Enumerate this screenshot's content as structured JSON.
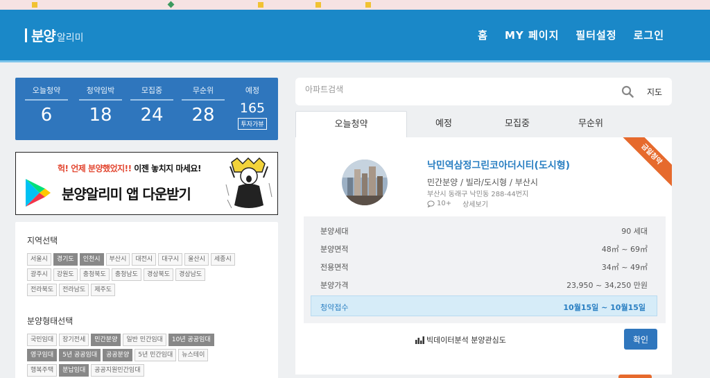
{
  "header": {
    "logo_main": "분양",
    "logo_sub": "알리미",
    "nav": [
      "홈",
      "MY 페이지",
      "필터설정",
      "로그인"
    ]
  },
  "stats": [
    {
      "label": "오늘청약",
      "value": "6"
    },
    {
      "label": "청약임박",
      "value": "18"
    },
    {
      "label": "모집중",
      "value": "24"
    },
    {
      "label": "무순위",
      "value": "28"
    },
    {
      "label": "예정",
      "value": "165",
      "button": "투자가뷰"
    }
  ],
  "banner": {
    "line1_a": "헉! 언제 분양했었지!!",
    "line1_b": " 이젠 놓치지 마세요!",
    "line2": "분양알리미 앱 다운받기"
  },
  "filters": {
    "region_title": "지역선택",
    "regions": [
      [
        {
          "t": "서울시",
          "on": false
        },
        {
          "t": "경기도",
          "on": true
        },
        {
          "t": "인천시",
          "on": true
        },
        {
          "t": "부산시",
          "on": false
        },
        {
          "t": "대전시",
          "on": false
        },
        {
          "t": "대구시",
          "on": false
        },
        {
          "t": "울산시",
          "on": false
        },
        {
          "t": "세종시",
          "on": false
        }
      ],
      [
        {
          "t": "광주시",
          "on": false
        },
        {
          "t": "강원도",
          "on": false
        },
        {
          "t": "충청북도",
          "on": false
        },
        {
          "t": "충청남도",
          "on": false
        },
        {
          "t": "경상북도",
          "on": false
        },
        {
          "t": "경상남도",
          "on": false
        }
      ],
      [
        {
          "t": "전라북도",
          "on": false
        },
        {
          "t": "전라남도",
          "on": false
        },
        {
          "t": "제주도",
          "on": false
        }
      ]
    ],
    "type_title": "분양형태선택",
    "types": [
      [
        {
          "t": "국민임대",
          "on": false
        },
        {
          "t": "장기전세",
          "on": false
        },
        {
          "t": "민간분양",
          "on": true
        },
        {
          "t": "일반 민간임대",
          "on": false
        },
        {
          "t": "10년 공공임대",
          "on": true
        }
      ],
      [
        {
          "t": "영구임대",
          "on": true
        },
        {
          "t": "5년 공공임대",
          "on": true
        },
        {
          "t": "공공분양",
          "on": true
        },
        {
          "t": "5년 민간임대",
          "on": false
        },
        {
          "t": "뉴스테이",
          "on": false
        }
      ],
      [
        {
          "t": "행복주택",
          "on": false
        },
        {
          "t": "분납임대",
          "on": true
        },
        {
          "t": "공공지원민간임대",
          "on": false
        }
      ]
    ]
  },
  "search": {
    "placeholder": "아파트검색",
    "map_label": "지도"
  },
  "tabs": [
    "오늘청약",
    "예정",
    "모집중",
    "무순위"
  ],
  "listing": {
    "ribbon": "금일청약",
    "title": "낙민역삼정그린코아더시티(도시형)",
    "type": "민간분양 / 빌라/도시형 / 부산시",
    "address": "부산시 동래구 낙민동 288-44번지",
    "comments": "10+",
    "detail_link": "상세보기",
    "rows": [
      {
        "k": "분양세대",
        "v": "90 세대"
      },
      {
        "k": "분양면적",
        "v": "48㎡ ~ 69㎡"
      },
      {
        "k": "전용면적",
        "v": "34㎡ ~ 49㎡"
      },
      {
        "k": "분양가격",
        "v": "23,950 ~ 34,250 만원"
      }
    ],
    "highlight": {
      "k": "청약접수",
      "v": "10월15일 ~ 10월15일"
    },
    "bigdata": "빅데이터분석 분양관심도",
    "confirm": "확인"
  },
  "colors": {
    "header": "#1a88c8",
    "stats": "#2f76bd",
    "accent": "#2a7fc2",
    "ribbon": "#e66a2d"
  }
}
